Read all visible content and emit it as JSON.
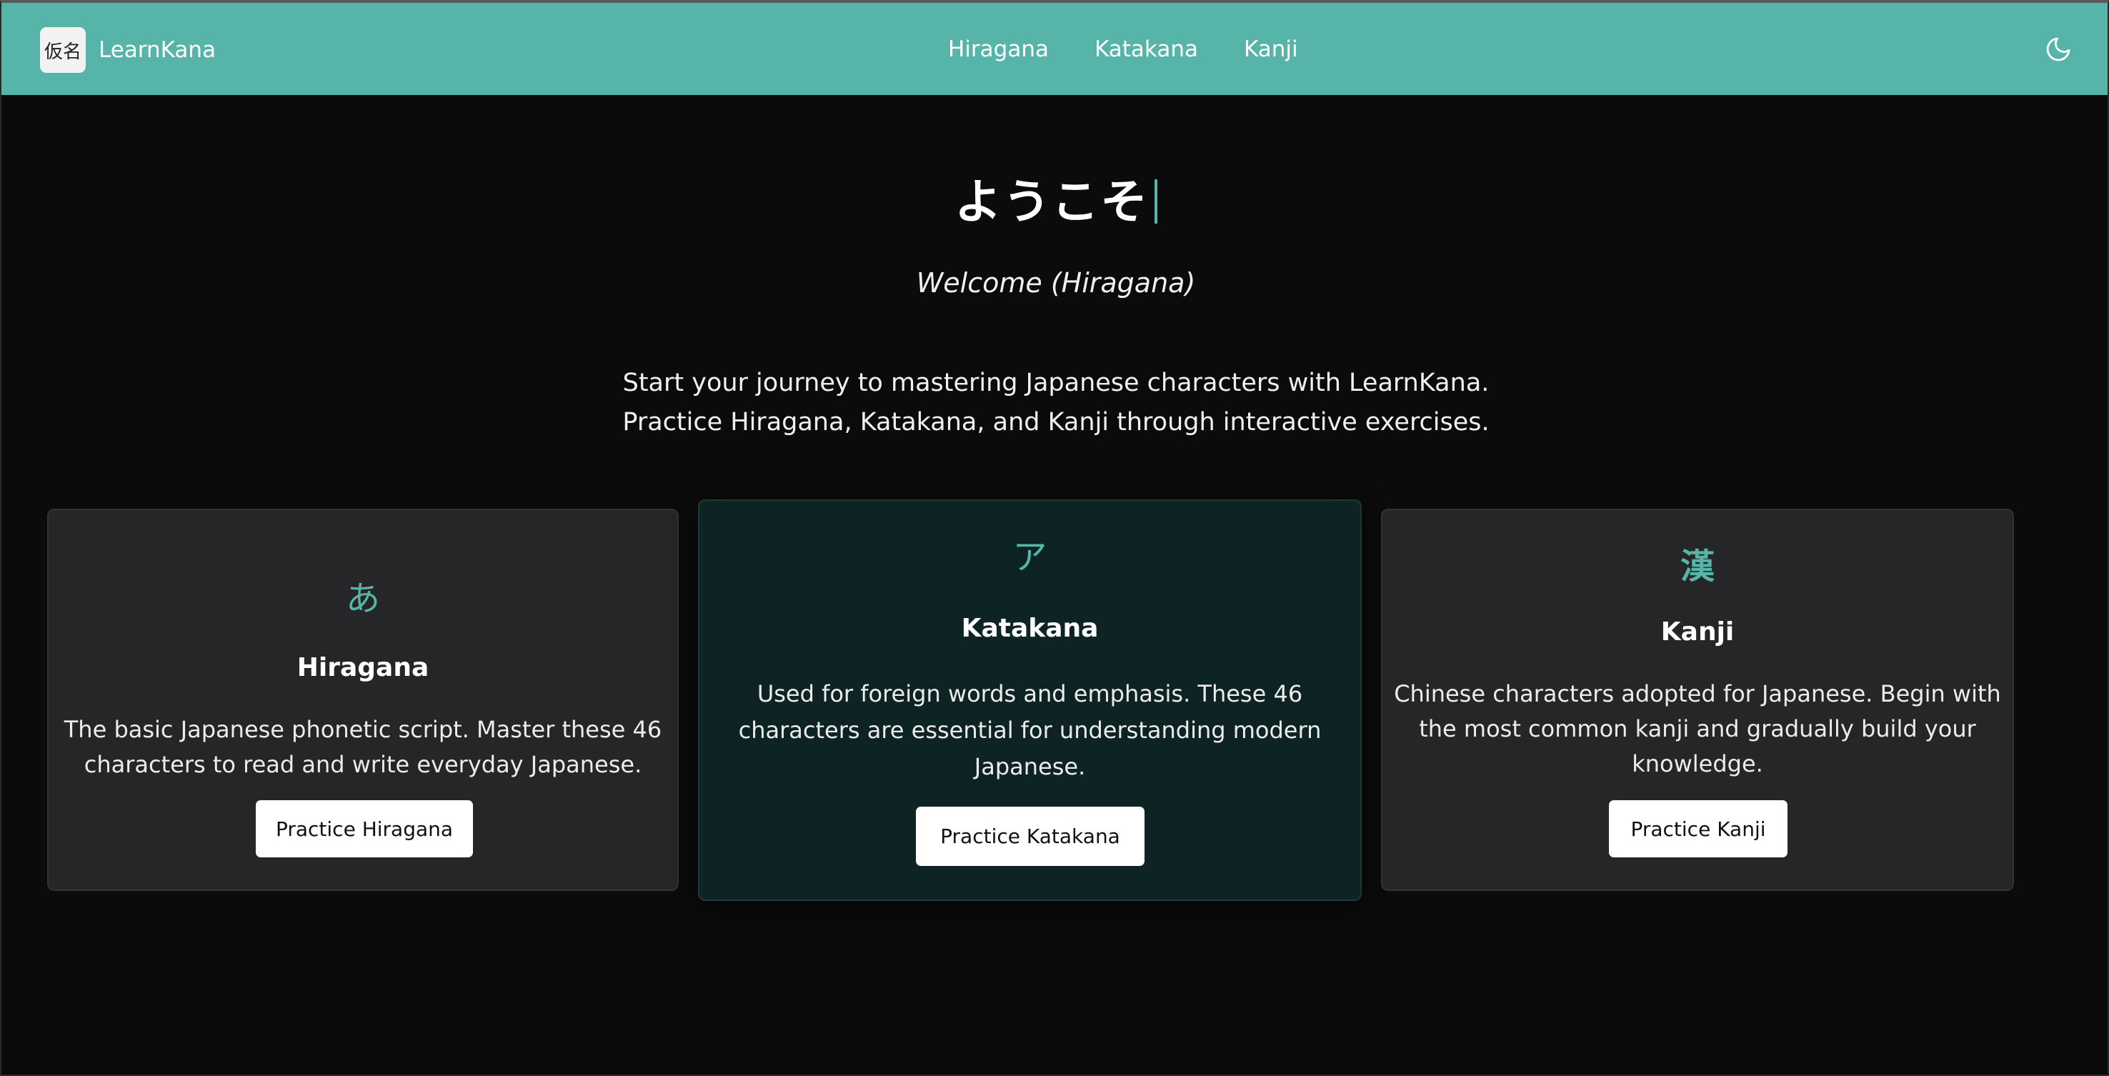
{
  "header": {
    "logo_text": "仮名",
    "brand": "LearnKana",
    "nav": [
      "Hiragana",
      "Katakana",
      "Kanji"
    ],
    "theme_icon": "moon-icon",
    "bg_color": "#56b5a8"
  },
  "hero": {
    "title": "ようこそ",
    "subtitle": "Welcome (Hiragana)",
    "description_line1": "Start your journey to mastering Japanese characters with LearnKana.",
    "description_line2": "Practice Hiragana, Katakana, and Kanji through interactive exercises."
  },
  "cards": [
    {
      "glyph": "あ",
      "title": "Hiragana",
      "lines": [
        "The basic Japanese phonetic script. Master these 46",
        "characters to read and write everyday Japanese."
      ],
      "button": "Practice Hiragana"
    },
    {
      "glyph": "ア",
      "title": "Katakana",
      "lines": [
        "Used for foreign words and emphasis. These 46",
        "characters are essential for understanding modern",
        "Japanese."
      ],
      "button": "Practice Katakana"
    },
    {
      "glyph": "漢",
      "title": "Kanji",
      "lines": [
        "Chinese characters adopted for Japanese. Begin with",
        "the most common kanji and gradually build your",
        "knowledge."
      ],
      "button": "Practice Kanji"
    }
  ],
  "colors": {
    "accent": "#56b5a8",
    "background": "#0b0b0c",
    "card": "#262628",
    "card_featured": "#0e2424"
  }
}
